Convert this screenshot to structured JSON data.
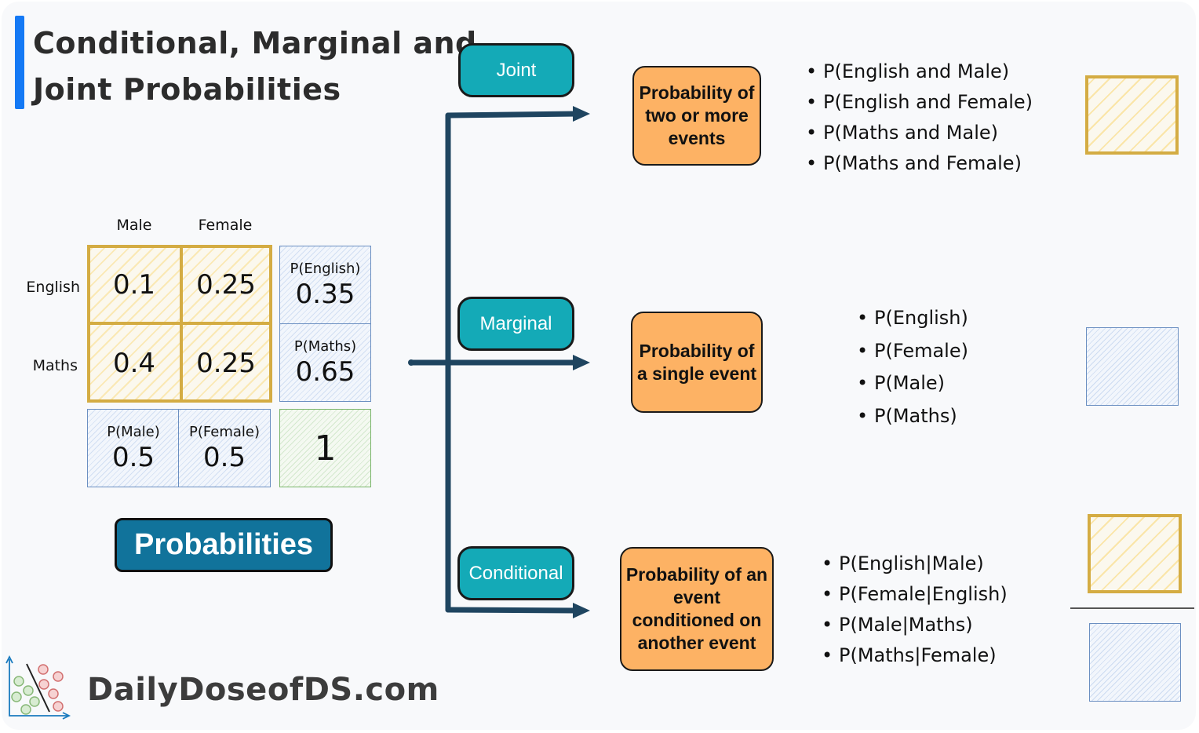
{
  "title": {
    "line1": "Conditional, Marginal and",
    "line2": "Joint Probabilities"
  },
  "table": {
    "col_labels": [
      "Male",
      "Female"
    ],
    "row_labels": [
      "English",
      "Maths"
    ],
    "joint": [
      [
        "0.1",
        "0.25"
      ],
      [
        "0.4",
        "0.25"
      ]
    ],
    "row_marginals": [
      {
        "label": "P(English)",
        "value": "0.35"
      },
      {
        "label": "P(Maths)",
        "value": "0.65"
      }
    ],
    "col_marginals": [
      {
        "label": "P(Male)",
        "value": "0.5"
      },
      {
        "label": "P(Female)",
        "value": "0.5"
      }
    ],
    "total": "1"
  },
  "probabilities_label": "Probabilities",
  "branches": [
    {
      "name": "Joint",
      "definition": "Probability of two or more events",
      "examples": [
        "P(English and Male)",
        "P(English and Female)",
        "P(Maths and Male)",
        "P(Maths and Female)"
      ],
      "legend": "joint-cells"
    },
    {
      "name": "Marginal",
      "definition": "Probability of a single event",
      "examples": [
        "P(English)",
        "P(Female)",
        "P(Male)",
        "P(Maths)"
      ],
      "legend": "marginal-cells"
    },
    {
      "name": "Conditional",
      "definition": "Probability of an event conditioned on another event",
      "examples": [
        "P(English|Male)",
        "P(Female|English)",
        "P(Male|Maths)",
        "P(Maths|Female)"
      ],
      "legend": "joint-over-marginal"
    }
  ],
  "colors": {
    "title_accent": "#1479f5",
    "joint_cell": "#d4ac43",
    "marginal_cell": "#6b8fc1",
    "total_cell": "#7ab56a",
    "teal_label": "#14aab7",
    "orange_box": "#fdb264",
    "arrow": "#1f4560",
    "probabilities_button": "#11739b"
  },
  "brand": "DailyDoseofDS.com"
}
